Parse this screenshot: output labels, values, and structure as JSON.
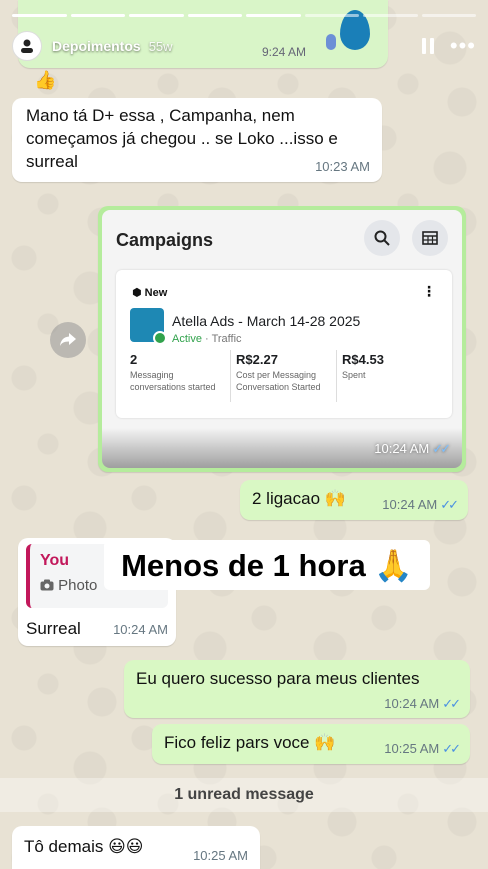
{
  "story": {
    "user": "Depoimentos",
    "time": "55w",
    "avatar_icon": "user-icon",
    "progress_segments": 8,
    "progress_done": 5
  },
  "top_audio": {
    "time": "9:24 AM",
    "reaction": "👍"
  },
  "msg1": {
    "text": "Mano tá D+ essa , Campanha, nem começamos já chegou .. se Loko ...isso e surreal",
    "time": "10:23 AM"
  },
  "campaigns_image": {
    "title": "Campaigns",
    "badge": "New",
    "ad_name": "Atella Ads - March 14-28 2025",
    "status": "Active",
    "status_sep": "·",
    "type": "Traffic",
    "stats": [
      {
        "value": "2",
        "label": "Messaging conversations started"
      },
      {
        "value": "R$2.27",
        "label": "Cost per Messaging Conversation Started"
      },
      {
        "value": "R$4.53",
        "label": "Spent"
      }
    ],
    "time": "10:24 AM"
  },
  "msg_ligacao": {
    "text": "2 ligacao 🙌",
    "time": "10:24 AM"
  },
  "reply": {
    "quote_name": "You",
    "quote_type": "Photo",
    "text": "Surreal",
    "time": "10:24 AM"
  },
  "overlay_text": "Menos de 1 hora 🙏",
  "msg_sucesso": {
    "text": "Eu quero sucesso para meus clientes",
    "time": "10:24 AM"
  },
  "msg_feliz": {
    "text": "Fico feliz pars voce 🙌",
    "time": "10:25 AM"
  },
  "unread": "1 unread message",
  "msg_demais": {
    "text": "Tô demais 😃😃",
    "time": "10:25 AM"
  },
  "ticks": "✓✓",
  "colors": {
    "outgoing_bubble": "#d9f8c4",
    "incoming_bubble": "#ffffff",
    "read_ticks": "#4a90e2",
    "quote_accent": "#c2185b"
  }
}
